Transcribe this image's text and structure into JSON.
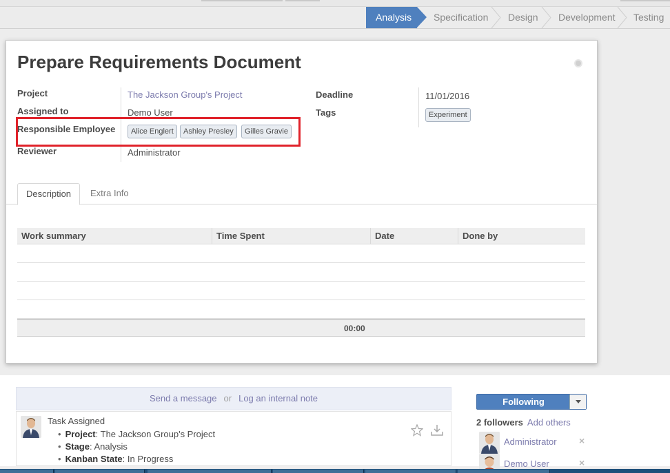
{
  "statusbar": {
    "stages": [
      "Analysis",
      "Specification",
      "Design",
      "Development",
      "Testing"
    ],
    "active_stage": "Analysis"
  },
  "record": {
    "title": "Prepare Requirements Document",
    "fields": {
      "project_label": "Project",
      "project_value": "The Jackson Group's Project",
      "assigned_label": "Assigned to",
      "assigned_value": "Demo User",
      "responsible_label": "Responsible Employee",
      "responsible_values": [
        "Alice Englert",
        "Ashley Presley",
        "Gilles Gravie"
      ],
      "reviewer_label": "Reviewer",
      "reviewer_value": "Administrator",
      "deadline_label": "Deadline",
      "deadline_value": "11/01/2016",
      "tags_label": "Tags",
      "tags_values": [
        "Experiment"
      ]
    }
  },
  "tabs": [
    "Description",
    "Extra Info"
  ],
  "work_table": {
    "columns": [
      "Work summary",
      "Time Spent",
      "Date",
      "Done by"
    ],
    "rows": [],
    "total": "00:00"
  },
  "chatter": {
    "send_message": "Send a message",
    "or": "or",
    "log_note": "Log an internal note",
    "message": {
      "title": "Task Assigned",
      "items": [
        {
          "key": "Project",
          "value": "The Jackson Group's Project"
        },
        {
          "key": "Stage",
          "value": "Analysis"
        },
        {
          "key": "Kanban State",
          "value": "In Progress"
        }
      ]
    },
    "following_button": "Following",
    "followers_count": "2 followers",
    "add_others": "Add others",
    "followers": [
      "Administrator",
      "Demo User"
    ],
    "remove_symbol": "×"
  },
  "colors": {
    "accent": "#4f80be",
    "link": "#7c7bad",
    "highlight": "#e0222a"
  }
}
